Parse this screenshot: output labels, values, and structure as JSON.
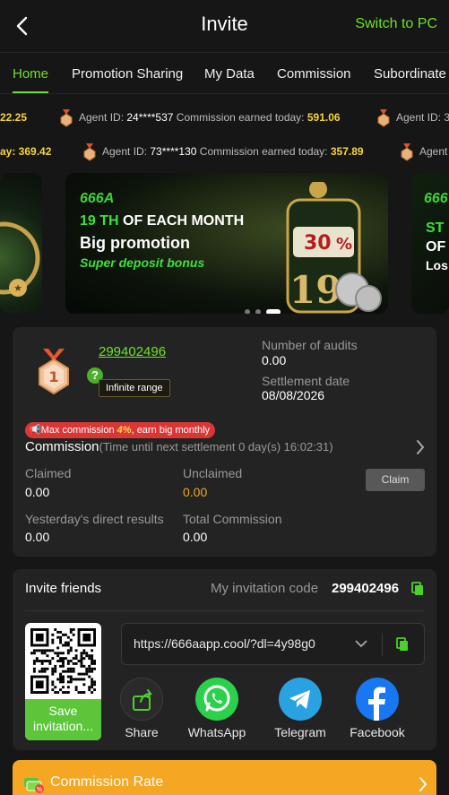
{
  "header": {
    "title": "Invite",
    "switch_pc": "Switch to PC"
  },
  "tabs": [
    {
      "label": "Home",
      "active": true
    },
    {
      "label": "Promotion Sharing"
    },
    {
      "label": "My Data"
    },
    {
      "label": "Commission"
    },
    {
      "label": "Subordinate I"
    }
  ],
  "ticker": {
    "row1": {
      "lead_amount": "22.25",
      "agent_label": "Agent ID:",
      "agent_id": "24****537",
      "commission_label": "Commission earned today:",
      "amount": "591.06",
      "trail": "Agent ID: 3"
    },
    "row2": {
      "lead_amount": "ay: 369.42",
      "agent_label": "Agent ID:",
      "agent_id": "73****130",
      "commission_label": "Commission earned today:",
      "amount": "357.89",
      "trail": "Agent"
    }
  },
  "banner": {
    "logo": "666A",
    "line1_a": "19 TH",
    "line1_b": " OF EACH MONTH",
    "line2": "Big promotion",
    "line3": "Super deposit bonus",
    "right_peek_logo": "666",
    "right_peek_l1": "ST",
    "right_peek_l2": "OF",
    "right_peek_l3": "Los",
    "slides": 3,
    "active_slide": 3
  },
  "agent": {
    "level": "1",
    "id": "299402496",
    "range": "Infinite range",
    "audits_label": "Number of audits",
    "audits_value": "0.00",
    "settlement_label": "Settlement date",
    "settlement_value": "08/08/2026"
  },
  "commission": {
    "max_prefix": "Max commission ",
    "max_pct": "4%",
    "max_suffix": ", earn big monthly",
    "title": "Commission",
    "subtitle": "(Time until next settlement  0 day(s) 16:02:31)",
    "claimed_label": "Claimed",
    "claimed_value": "0.00",
    "unclaimed_label": "Unclaimed",
    "unclaimed_value": "0.00",
    "claim_button": "Claim",
    "yesterday_label": "Yesterday's direct results",
    "yesterday_value": "0.00",
    "total_label": "Total Commission",
    "total_value": "0.00"
  },
  "invite": {
    "title": "Invite friends",
    "code_label": "My invitation code",
    "code": "299402496",
    "url": "https://666aapp.cool/?dl=4y98g0",
    "save_button": "Save invitation...",
    "share": [
      {
        "label": "Share",
        "icon": "share-icon",
        "color": "#2a2a2a"
      },
      {
        "label": "WhatsApp",
        "icon": "whatsapp-icon",
        "color": "#2bd14b"
      },
      {
        "label": "Telegram",
        "icon": "telegram-icon",
        "color": "#2aa1e0"
      },
      {
        "label": "Facebook",
        "icon": "facebook-icon",
        "color": "#1877f2"
      }
    ]
  },
  "rate": {
    "label": "Commission Rate"
  },
  "colors": {
    "accent": "#6ee02a",
    "amount": "#f5d53c",
    "rate_bar": "#f5a623",
    "unclaimed": "#f5a524"
  }
}
